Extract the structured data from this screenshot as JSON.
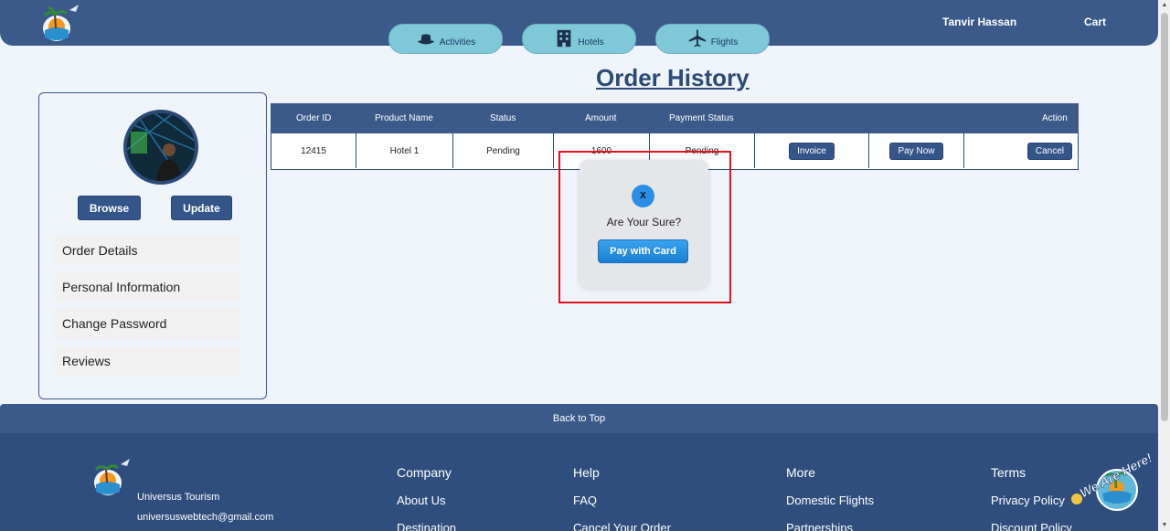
{
  "header": {
    "user_name": "Tanvir Hassan",
    "cart_label": "Cart",
    "nav": [
      {
        "label": "Activities",
        "icon": "hat-icon"
      },
      {
        "label": "Hotels",
        "icon": "hotel-icon"
      },
      {
        "label": "Flights",
        "icon": "plane-icon"
      }
    ]
  },
  "page_title": "Order History",
  "sidebar": {
    "browse_label": "Browse",
    "update_label": "Update",
    "menu": [
      "Order Details",
      "Personal Information",
      "Change Password",
      "Reviews"
    ]
  },
  "table": {
    "headers": [
      "Order ID",
      "Product Name",
      "Status",
      "Amount",
      "Payment Status",
      "Action"
    ],
    "rows": [
      {
        "order_id": "12415",
        "product": "Hotel 1",
        "status": "Pending",
        "amount": "1600",
        "payment_status": "Pending",
        "invoice_label": "Invoice",
        "pay_label": "Pay Now",
        "cancel_label": "Cancel"
      }
    ]
  },
  "modal": {
    "close_label": "X",
    "message": "Are Your Sure?",
    "pay_label": "Pay with Card"
  },
  "footer": {
    "back_to_top": "Back to Top",
    "brand": "Universus Tourism",
    "email": "universuswebtech@gmail.com",
    "columns": [
      {
        "title": "Company",
        "links": [
          "About Us",
          "Destination"
        ]
      },
      {
        "title": "Help",
        "links": [
          "FAQ",
          "Cancel Your Order"
        ]
      },
      {
        "title": "More",
        "links": [
          "Domestic Flights",
          "Partnerships"
        ]
      },
      {
        "title": "Terms",
        "links": [
          "Privacy Policy",
          "Discount Policy"
        ]
      }
    ],
    "badge_text": "We Are Here!"
  },
  "colors": {
    "primary": "#3b5a8a",
    "nav_pill": "#7ec8d8",
    "highlight": "#e0131b",
    "pay_button": "#1a7fd3"
  }
}
